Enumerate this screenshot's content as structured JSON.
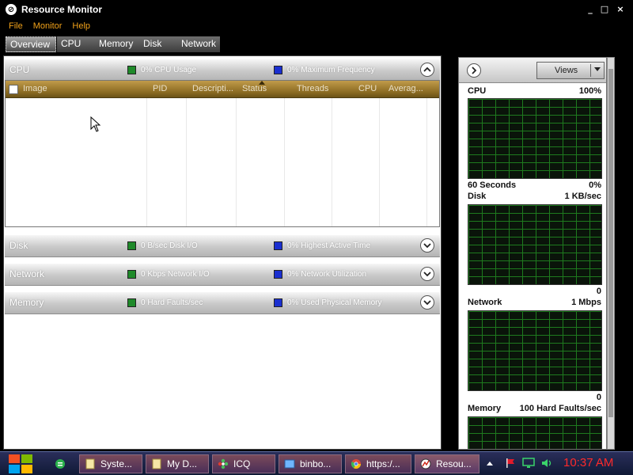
{
  "window": {
    "title": "Resource Monitor",
    "icon": "resource-monitor-icon"
  },
  "window_controls": {
    "minimize": "_",
    "maximize": "□",
    "close": "×"
  },
  "menu": {
    "file": "File",
    "monitor": "Monitor",
    "help": "Help"
  },
  "tabs": {
    "overview": "Overview",
    "cpu": "CPU",
    "memory": "Memory",
    "disk": "Disk",
    "network": "Network",
    "active": "Overview"
  },
  "sections": {
    "cpu": {
      "title": "CPU",
      "legend1": "0% CPU Usage",
      "legend2": "0% Maximum Frequency",
      "expanded": true
    },
    "disk": {
      "title": "Disk",
      "legend1": "0 B/sec Disk I/O",
      "legend2": "0% Highest Active Time",
      "expanded": false
    },
    "network": {
      "title": "Network",
      "legend1": "0 Kbps Network I/O",
      "legend2": "0% Network Utilization",
      "expanded": false
    },
    "memory": {
      "title": "Memory",
      "legend1": "0 Hard Faults/sec",
      "legend2": "0% Used Physical Memory",
      "expanded": false
    }
  },
  "cpu_table": {
    "columns": [
      "Image",
      "PID",
      "Descripti...",
      "Status",
      "Threads",
      "CPU",
      "Averag..."
    ],
    "sorted_column": "Status",
    "rows": []
  },
  "right_panel": {
    "views_label": "Views",
    "graphs": [
      {
        "name": "CPU",
        "top_value": "100%",
        "bottom_left": "60 Seconds",
        "bottom_right": "0%"
      },
      {
        "name": "Disk",
        "top_value": "1 KB/sec",
        "bottom_left": "",
        "bottom_right": "0"
      },
      {
        "name": "Network",
        "top_value": "1 Mbps",
        "bottom_left": "",
        "bottom_right": "0"
      },
      {
        "name": "Memory",
        "top_value": "100 Hard Faults/sec",
        "bottom_left": "",
        "bottom_right": ""
      }
    ]
  },
  "taskbar": {
    "items": [
      {
        "label": "",
        "icon": "app-green-icon"
      },
      {
        "label": "Syste...",
        "icon": "folder-icon"
      },
      {
        "label": "My D...",
        "icon": "folder-icon"
      },
      {
        "label": "ICQ",
        "icon": "icq-flower-icon"
      },
      {
        "label": "binbo...",
        "icon": "window-app-icon"
      },
      {
        "label": "https:/...",
        "icon": "chrome-icon"
      },
      {
        "label": "Resou...",
        "icon": "resource-monitor-icon"
      }
    ],
    "clock": "10:37 AM"
  },
  "colors": {
    "legend_green": "#1f8a2a",
    "legend_blue": "#1a2fd0",
    "graph_grid": "#1e7a1e",
    "menu_text": "#f2a21a",
    "clock": "#ff2a2a"
  }
}
